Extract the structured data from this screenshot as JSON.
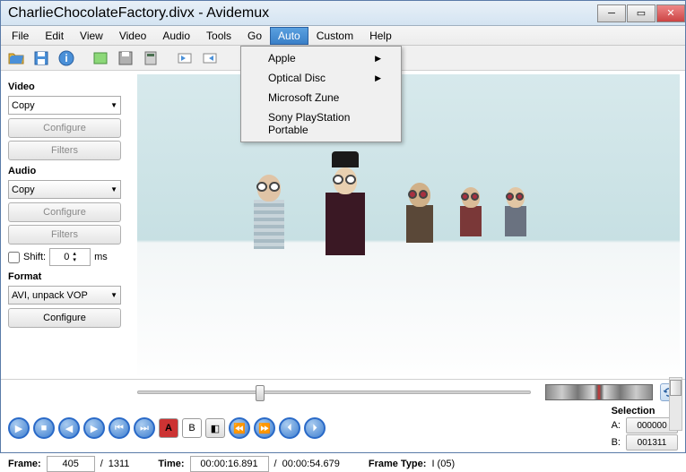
{
  "window": {
    "title": "CharlieChocolateFactory.divx - Avidemux"
  },
  "menubar": [
    "File",
    "Edit",
    "View",
    "Video",
    "Audio",
    "Tools",
    "Go",
    "Auto",
    "Custom",
    "Help"
  ],
  "menubar_active": "Auto",
  "dropdown": {
    "items": [
      {
        "label": "Apple",
        "submenu": true
      },
      {
        "label": "Optical Disc",
        "submenu": true
      },
      {
        "label": "Microsoft Zune",
        "submenu": false
      },
      {
        "label": "Sony PlayStation Portable",
        "submenu": false
      }
    ]
  },
  "sidebar": {
    "video": {
      "label": "Video",
      "codec": "Copy",
      "configure": "Configure",
      "filters": "Filters"
    },
    "audio": {
      "label": "Audio",
      "codec": "Copy",
      "configure": "Configure",
      "filters": "Filters",
      "shift_label": "Shift:",
      "shift_value": "0",
      "shift_unit": "ms"
    },
    "format": {
      "label": "Format",
      "container": "AVI, unpack VOP",
      "configure": "Configure"
    }
  },
  "selection": {
    "title": "Selection",
    "a_label": "A:",
    "a_value": "000000",
    "b_label": "B:",
    "b_value": "001311"
  },
  "status": {
    "frame_label": "Frame:",
    "frame_current": "405",
    "frame_sep": "/",
    "frame_total": "1311",
    "time_label": "Time:",
    "time_current": "00:00:16.891",
    "time_sep": "/",
    "time_total": "00:00:54.679",
    "frametype_label": "Frame Type:",
    "frametype_value": "I (05)"
  },
  "marks": {
    "a": "A",
    "b": "B"
  }
}
